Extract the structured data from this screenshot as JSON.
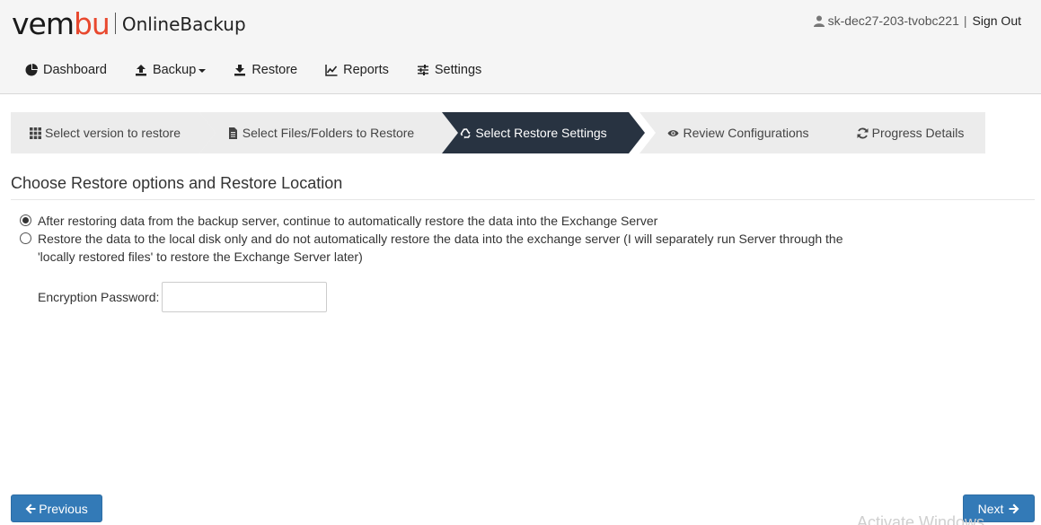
{
  "brand": {
    "logo_prefix": "vem",
    "logo_accent": "bu",
    "product": "OnlineBackup"
  },
  "user": {
    "name": "sk-dec27-203-tvobc221",
    "separator": "|",
    "signout": "Sign Out"
  },
  "nav": {
    "dashboard": "Dashboard",
    "backup": "Backup",
    "restore": "Restore",
    "reports": "Reports",
    "settings": "Settings"
  },
  "wizard": {
    "steps": [
      {
        "label": "Select version to restore",
        "icon": "grid-icon"
      },
      {
        "label": "Select Files/Folders to Restore",
        "icon": "file-icon"
      },
      {
        "label": "Select Restore Settings",
        "icon": "recycle-icon",
        "active": true
      },
      {
        "label": "Review Configurations",
        "icon": "eye-icon"
      },
      {
        "label": "Progress Details",
        "icon": "refresh-icon"
      }
    ]
  },
  "content": {
    "title": "Choose Restore options and Restore Location",
    "option1": "After restoring data from the backup server, continue to automatically restore the data into the Exchange Server",
    "option2": "Restore the data to the local disk only and do not automatically restore the data into the exchange server (I will separately run Server through the 'locally restored files' to restore the Exchange Server later)",
    "selected_option": 1,
    "password_label": "Encryption Password:",
    "password_value": ""
  },
  "footer": {
    "previous": "Previous",
    "next": "Next"
  },
  "watermark": "Activate Windows",
  "colors": {
    "active_step": "#283341",
    "primary_button": "#337ab7",
    "brand_accent": "#e8482e"
  }
}
